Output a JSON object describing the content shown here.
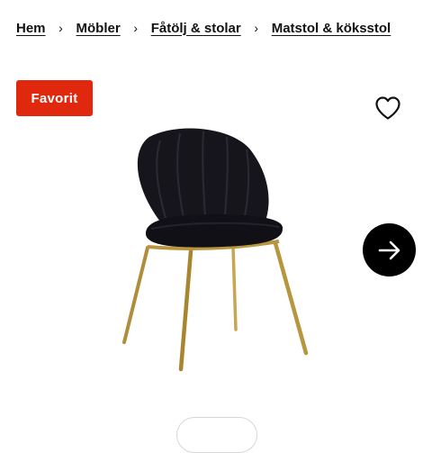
{
  "breadcrumb": {
    "items": [
      {
        "label": "Hem"
      },
      {
        "label": "Möbler"
      },
      {
        "label": "Fåtölj & stolar"
      },
      {
        "label": "Matstol & köksstol"
      }
    ],
    "separator": "›"
  },
  "product": {
    "badge": "Favorit",
    "badge_color": "#e0280e",
    "image_subject": "black velvet dining chair with gold legs",
    "favorite_icon": "heart-outline-icon",
    "next_icon": "arrow-right-icon"
  },
  "footer": {
    "pill_label": ""
  }
}
